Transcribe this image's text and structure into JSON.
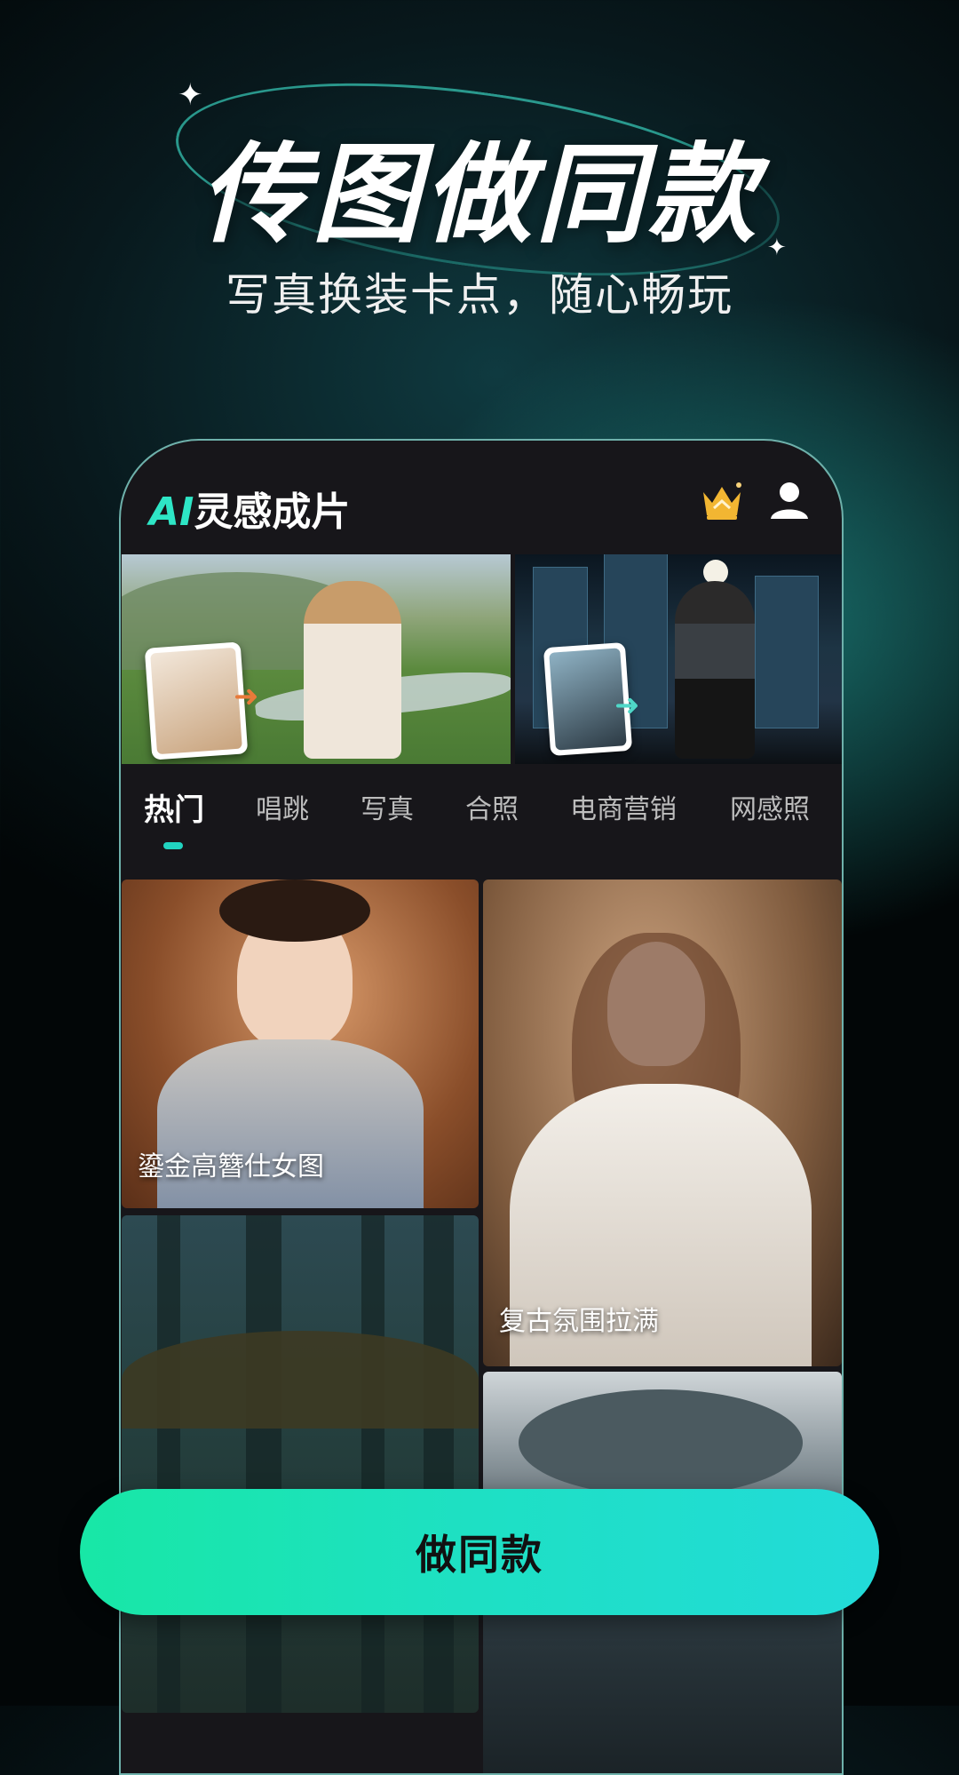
{
  "hero": {
    "title": "传图做同款",
    "subtitle": "写真换装卡点，随心畅玩"
  },
  "app": {
    "logo_ai": "AI",
    "logo_text": "灵感成片",
    "vip_icon": "crown-icon",
    "user_icon": "user-icon"
  },
  "banners": [
    {
      "name": "outfit-swap-banner",
      "arrow_icon": "arrow-right-icon"
    },
    {
      "name": "city-night-banner",
      "arrow_icon": "arrow-right-icon"
    }
  ],
  "tabs": [
    {
      "label": "热门",
      "active": true
    },
    {
      "label": "唱跳",
      "active": false
    },
    {
      "label": "写真",
      "active": false
    },
    {
      "label": "合照",
      "active": false
    },
    {
      "label": "电商营销",
      "active": false
    },
    {
      "label": "网感照",
      "active": false
    }
  ],
  "cards": [
    {
      "caption": "鎏金高簪仕女图"
    },
    {
      "caption": "复古氛围拉满"
    },
    {
      "caption": ""
    },
    {
      "caption": ""
    }
  ],
  "cta": {
    "label": "做同款"
  },
  "colors": {
    "accent": "#21d3c0",
    "cta_start": "#18e7a6",
    "cta_end": "#22dbd9",
    "vip": "#f2b632"
  }
}
